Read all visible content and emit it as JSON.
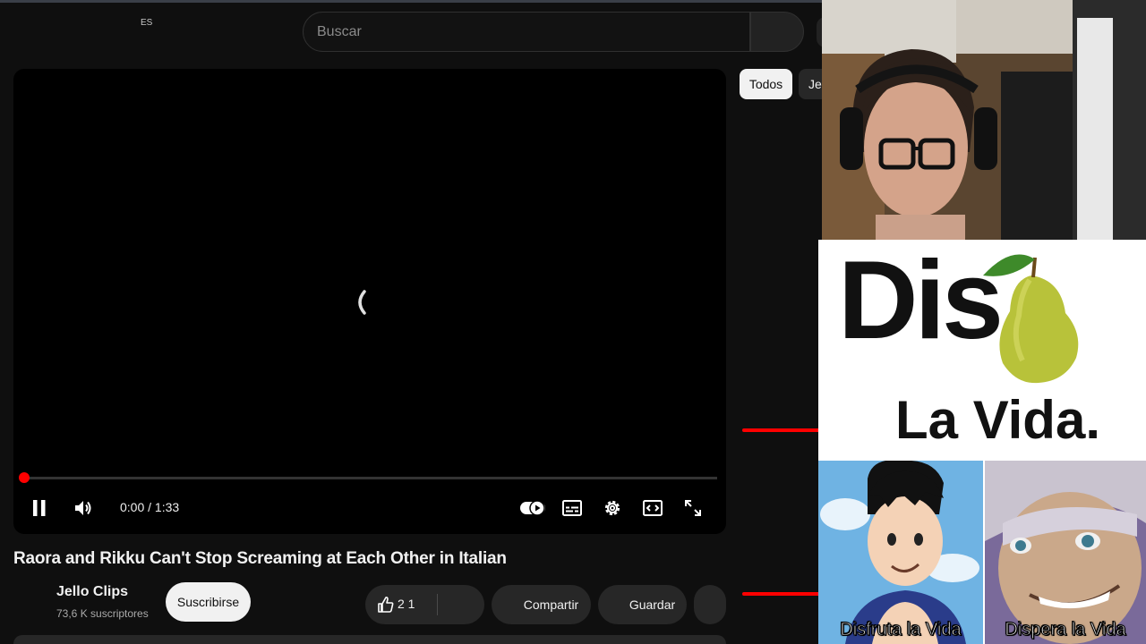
{
  "header": {
    "lang_badge": "ES",
    "search_placeholder": "Buscar"
  },
  "player": {
    "time": "0:00 / 1:33",
    "progress": 0.0,
    "autoplay": "on",
    "icons": [
      "pause-icon",
      "volume-icon",
      "autoplay-toggle-icon",
      "subtitles-icon",
      "settings-icon",
      "theater-icon",
      "fullscreen-icon"
    ]
  },
  "video": {
    "title": "Raora and Rikku Can't Stop Screaming at Each Other in Italian",
    "channel": "Jello Clips",
    "subscribers": "73,6 K suscriptores",
    "subscribe_label": "Suscribirse",
    "like_count": "2 1",
    "share_label": "Compartir",
    "save_label": "Guardar"
  },
  "chips": {
    "active": "Todos",
    "next": "Je"
  },
  "meme": {
    "big_text": "Dis",
    "subtitle": "La Vida.",
    "caption_left": "Disfruta la Vida",
    "caption_right": "Dispera la Vida"
  },
  "colors": {
    "background": "#0f0f0f",
    "accent_red": "#ff0000",
    "pill": "#272727"
  }
}
